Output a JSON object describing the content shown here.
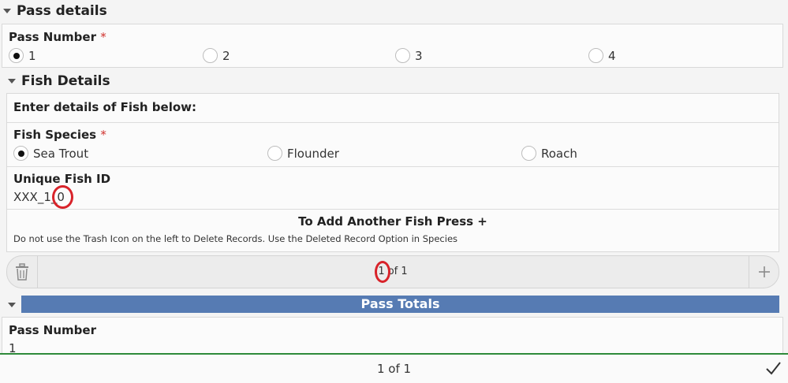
{
  "pass_details": {
    "title": "Pass details",
    "pass_number": {
      "label": "Pass Number",
      "required_mark": "*",
      "options": [
        "1",
        "2",
        "3",
        "4"
      ],
      "selected": "1"
    }
  },
  "fish_details": {
    "title": "Fish Details",
    "instruction": "Enter details of Fish below:",
    "species": {
      "label": "Fish Species",
      "required_mark": "*",
      "options": [
        "Sea Trout",
        "Flounder",
        "Roach"
      ],
      "selected": "Sea Trout"
    },
    "unique_id": {
      "label": "Unique Fish ID",
      "prefix": "XXX_1_",
      "highlighted": "0"
    },
    "add_note": {
      "title": "To Add Another Fish Press +",
      "subtitle": "Do not use the Trash Icon on the left to Delete Records. Use the Deleted Record Option in Species"
    },
    "pager": {
      "current": "1",
      "rest": " of 1",
      "trash_icon": "trash-icon",
      "add_icon": "plus-icon"
    }
  },
  "pass_totals": {
    "title": "Pass Totals",
    "pass_number_label": "Pass Number",
    "pass_number_value": "1"
  },
  "footer": {
    "pagination": "1 of 1",
    "submit_icon": "checkmark-icon"
  },
  "colors": {
    "section_bar": "#567bb3",
    "required": "#d0312d",
    "annotation_ring": "#d8232a",
    "footer_accent": "#2e8a3a"
  }
}
